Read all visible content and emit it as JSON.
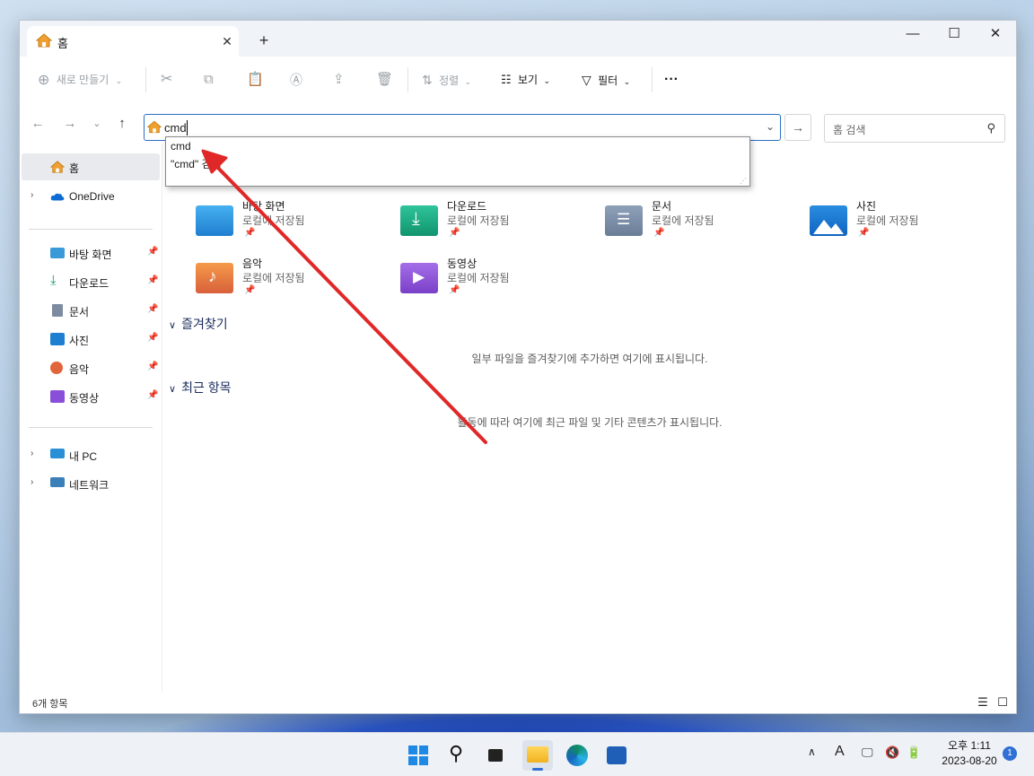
{
  "window": {
    "tab_title": "홈",
    "tab_close": "✕",
    "new_tab": "+",
    "minimize": "—",
    "maximize": "☐",
    "close": "✕"
  },
  "toolbar": {
    "new_label": "새로 만들기",
    "sort_label": "정렬",
    "view_label": "보기",
    "filter_label": "필터",
    "more_label": "···"
  },
  "address": {
    "value": "cmd",
    "search_placeholder": "홈 검색"
  },
  "dropdown": {
    "items": [
      "cmd",
      "\"cmd\" 검색"
    ]
  },
  "sidebar": {
    "home": "홈",
    "onedrive": "OneDrive",
    "pinned": [
      "바탕 화면",
      "다운로드",
      "문서",
      "사진",
      "음악",
      "동영상"
    ],
    "this_pc": "내 PC",
    "network": "네트워크"
  },
  "quick_access": [
    {
      "name": "바탕 화면",
      "sub": "로컬에 저장됨"
    },
    {
      "name": "다운로드",
      "sub": "로컬에 저장됨"
    },
    {
      "name": "문서",
      "sub": "로컬에 저장됨"
    },
    {
      "name": "사진",
      "sub": "로컬에 저장됨"
    },
    {
      "name": "음악",
      "sub": "로컬에 저장됨"
    },
    {
      "name": "동영상",
      "sub": "로컬에 저장됨"
    }
  ],
  "sections": {
    "favorites": "즐겨찾기",
    "favorites_empty": "일부 파일을 즐겨찾기에 추가하면 여기에 표시됩니다.",
    "recent": "최근 항목",
    "recent_empty": "활동에 따라 여기에 최근 파일 및 기타 콘텐츠가 표시됩니다."
  },
  "status": {
    "count": "6개 항목"
  },
  "taskbar": {
    "time": "오후 1:11",
    "date": "2023-08-20",
    "notifications": "1",
    "ime": "A"
  },
  "colors": {
    "accent": "#2d6fc4",
    "annotation_arrow": "#e02828"
  }
}
